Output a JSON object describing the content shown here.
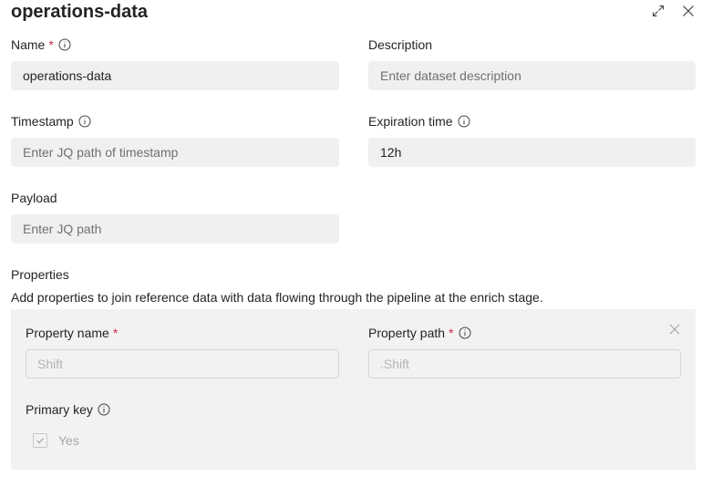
{
  "header": {
    "title": "operations-data"
  },
  "fields": {
    "name": {
      "label": "Name",
      "required_mark": "*",
      "value": "operations-data"
    },
    "description": {
      "label": "Description",
      "placeholder": "Enter dataset description"
    },
    "timestamp": {
      "label": "Timestamp",
      "placeholder": "Enter JQ path of timestamp"
    },
    "expiration": {
      "label": "Expiration time",
      "value": "12h"
    },
    "payload": {
      "label": "Payload",
      "placeholder": "Enter JQ path"
    }
  },
  "properties": {
    "heading": "Properties",
    "description": "Add properties to join reference data with data flowing through the pipeline at the enrich stage.",
    "item": {
      "name_label": "Property name",
      "name_required_mark": "*",
      "name_placeholder": "Shift",
      "path_label": "Property path",
      "path_required_mark": "*",
      "path_placeholder": ".Shift",
      "primary_key_label": "Primary key",
      "primary_key_checked": true,
      "primary_key_option": "Yes"
    }
  },
  "colors": {
    "required": "#c4314b",
    "field_bg": "#f0f0f0",
    "panel_bg": "#f3f2f1"
  }
}
